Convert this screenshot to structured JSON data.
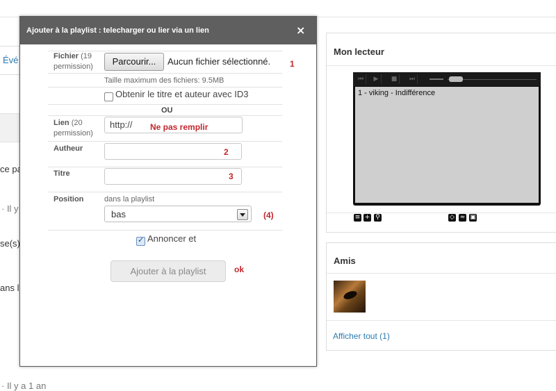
{
  "background": {
    "left_tab": "Évé",
    "fragments": [
      "ce pa",
      "· Il y",
      "se(s)",
      "ans l",
      "· Il y a 1 an"
    ]
  },
  "my_player": {
    "title": "Mon lecteur",
    "track": "1 - viking - Indifférence",
    "icons": [
      "list-icon",
      "add-icon",
      "link-icon",
      "embed-icon",
      "rss-icon",
      "popup-icon"
    ]
  },
  "friends": {
    "title": "Amis",
    "show_all": "Afficher tout (1)"
  },
  "modal": {
    "title": "Ajouter à la playlist : telecharger ou lier via un lien",
    "close": "×",
    "file": {
      "label": "Fichier",
      "sub": "(19",
      "sub2": "permission)",
      "browse": "Parcourir...",
      "no_file": "Aucun fichier sélectionné.",
      "annotation": "1",
      "max_size": "Taille maximum des fichiers: 9.5MB"
    },
    "id3": {
      "label": "Obtenir le titre et auteur avec ID3",
      "checked": false
    },
    "or": "OU",
    "link": {
      "label": "Lien",
      "sub": "(20",
      "sub2": "permission)",
      "value": "http://",
      "annotation": "Ne pas remplir"
    },
    "author": {
      "label": "Autheur",
      "value": "",
      "annotation": "2"
    },
    "title_field": {
      "label": "Titre",
      "value": "",
      "annotation": "3"
    },
    "position": {
      "label": "Position",
      "hint": "dans la playlist",
      "selected": "bas",
      "annotation": "(4)"
    },
    "announce": {
      "label": "Annoncer et",
      "checked": true
    },
    "submit": {
      "label": "Ajouter à la playlist",
      "annotation": "ok"
    }
  }
}
